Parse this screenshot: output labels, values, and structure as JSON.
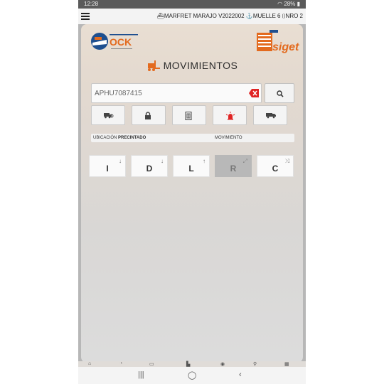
{
  "status_bar": {
    "time": "12:28",
    "battery": "28%"
  },
  "header": {
    "vessel": "MARFRET MARAJO",
    "voyage": "V2022002",
    "dock": "MUELLE 6",
    "nro": "NRO 2"
  },
  "logos": {
    "left": "OCK",
    "right": "siget"
  },
  "page": {
    "title": "MOVIMIENTOS"
  },
  "search": {
    "value": "APHU7087415"
  },
  "info_bar": {
    "location_label": "UBICACIÓN",
    "location_value": "PRECINTADO",
    "movement_label": "MOVIMIENTO"
  },
  "moves": [
    {
      "letter": "I",
      "arrow": "↓",
      "enabled": true
    },
    {
      "letter": "D",
      "arrow": "↓",
      "enabled": true
    },
    {
      "letter": "L",
      "arrow": "↑",
      "enabled": true
    },
    {
      "letter": "R",
      "arrow": "⤢",
      "enabled": false
    },
    {
      "letter": "C",
      "arrow": "⤨",
      "enabled": true
    }
  ],
  "colors": {
    "accent": "#e36a1e",
    "danger": "#e02424",
    "status_bar": "#5a5a5a"
  }
}
